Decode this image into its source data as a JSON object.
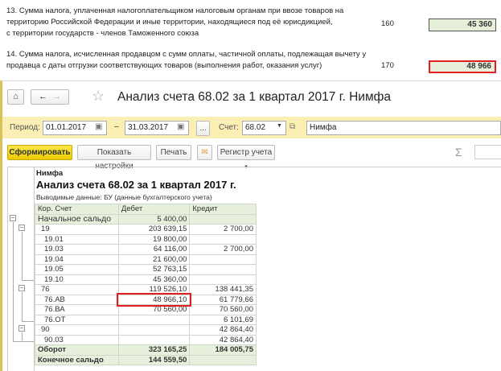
{
  "declaration": {
    "line13": [
      "13. Сумма налога, уплаченная налогоплательщиком налоговым органам при ввозе товаров на",
      "территорию Российской Федерации и иные территории, находящиеся под её юрисдикцией,",
      "с территории государств - членов Таможенного союза"
    ],
    "code13": "160",
    "value13": "45 360",
    "line14": [
      "14. Сумма налога, исчисленная продавцом с сумм оплаты, частичной оплаты, подлежащая вычету у",
      "продавца с даты отгрузки соответствующих товаров (выполнения работ, оказания услуг)"
    ],
    "code14": "170",
    "value14": "48 966"
  },
  "window": {
    "title": "Анализ счета 68.02 за 1 квартал 2017 г. Нимфа"
  },
  "filter": {
    "period_label": "Период:",
    "date_from": "01.01.2017",
    "dash": "–",
    "date_to": "31.03.2017",
    "ellipsis": "...",
    "account_label": "Счет:",
    "account": "68.02",
    "org": "Нимфа"
  },
  "toolbar": {
    "generate": "Сформировать",
    "show_settings": "Показать настройки",
    "print": "Печать",
    "register": "Регистр учета",
    "sigma": "Σ"
  },
  "report": {
    "org": "Нимфа",
    "title": "Анализ счета 68.02 за 1 квартал 2017 г.",
    "output_data": "Выводимые данные:  БУ (данные бухгалтерского учета)",
    "headers": [
      "Кор. Счет",
      "Дебет",
      "Кредит"
    ],
    "rows": [
      [
        "Начальное сальдо",
        "5 400,00",
        ""
      ],
      [
        "19",
        "203 639,15",
        "2 700,00"
      ],
      [
        "19.01",
        "19 800,00",
        ""
      ],
      [
        "19.03",
        "64 116,00",
        "2 700,00"
      ],
      [
        "19.04",
        "21 600,00",
        ""
      ],
      [
        "19.05",
        "52 763,15",
        ""
      ],
      [
        "19.10",
        "45 360,00",
        ""
      ],
      [
        "76",
        "119 526,10",
        "138 441,35"
      ],
      [
        "76.АВ",
        "48 966,10",
        "61 779,66"
      ],
      [
        "76.ВА",
        "70 560,00",
        "70 560,00"
      ],
      [
        "76.ОТ",
        "",
        "6 101,69"
      ],
      [
        "90",
        "",
        "42 864,40"
      ],
      [
        "90.03",
        "",
        "42 864,40"
      ],
      [
        "Оборот",
        "323 165,25",
        "184 005,75"
      ],
      [
        "Конечное сальдо",
        "144 559,50",
        ""
      ]
    ]
  },
  "colors": {
    "highlight": "#e02020",
    "filter_bg": "#fbefb4",
    "generate_btn": "#f5d90a"
  }
}
